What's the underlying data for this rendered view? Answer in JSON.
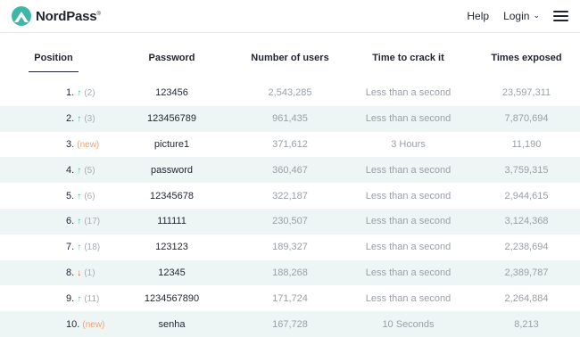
{
  "header": {
    "brand": "NordPass",
    "brand_mark": "®",
    "help": "Help",
    "login": "Login",
    "login_chevron": "⌄"
  },
  "table": {
    "columns": [
      "Position",
      "Password",
      "Number of users",
      "Time to crack it",
      "Times exposed"
    ],
    "rows": [
      {
        "pos": "1.",
        "trend": "up",
        "arrow": "↑",
        "change": "(2)",
        "password": "123456",
        "users": "2,543,285",
        "crack": "Less than a second",
        "exposed": "23,597,311"
      },
      {
        "pos": "2.",
        "trend": "up",
        "arrow": "↑",
        "change": "(3)",
        "password": "123456789",
        "users": "961,435",
        "crack": "Less than a second",
        "exposed": "7,870,694"
      },
      {
        "pos": "3.",
        "trend": "new",
        "arrow": "",
        "change": "(new)",
        "password": "picture1",
        "users": "371,612",
        "crack": "3 Hours",
        "exposed": "11,190"
      },
      {
        "pos": "4.",
        "trend": "up",
        "arrow": "↑",
        "change": "(5)",
        "password": "password",
        "users": "360,467",
        "crack": "Less than a second",
        "exposed": "3,759,315"
      },
      {
        "pos": "5.",
        "trend": "up",
        "arrow": "↑",
        "change": "(6)",
        "password": "12345678",
        "users": "322,187",
        "crack": "Less than a second",
        "exposed": "2,944,615"
      },
      {
        "pos": "6.",
        "trend": "up",
        "arrow": "↑",
        "change": "(17)",
        "password": "111111",
        "users": "230,507",
        "crack": "Less than a second",
        "exposed": "3,124,368"
      },
      {
        "pos": "7.",
        "trend": "up",
        "arrow": "↑",
        "change": "(18)",
        "password": "123123",
        "users": "189,327",
        "crack": "Less than a second",
        "exposed": "2,238,694"
      },
      {
        "pos": "8.",
        "trend": "down",
        "arrow": "↓",
        "change": "(1)",
        "password": "12345",
        "users": "188,268",
        "crack": "Less than a second",
        "exposed": "2,389,787"
      },
      {
        "pos": "9.",
        "trend": "up",
        "arrow": "↑",
        "change": "(11)",
        "password": "1234567890",
        "users": "171,724",
        "crack": "Less than a second",
        "exposed": "2,264,884"
      },
      {
        "pos": "10.",
        "trend": "new",
        "arrow": "",
        "change": "(new)",
        "password": "senha",
        "users": "167,728",
        "crack": "10 Seconds",
        "exposed": "8,213"
      }
    ]
  },
  "colors": {
    "accent": "#3fb7a6",
    "up": "#3fb7a6",
    "down": "#e25b4b",
    "new": "#f2a06f",
    "row_alt": "#eef6f5"
  }
}
